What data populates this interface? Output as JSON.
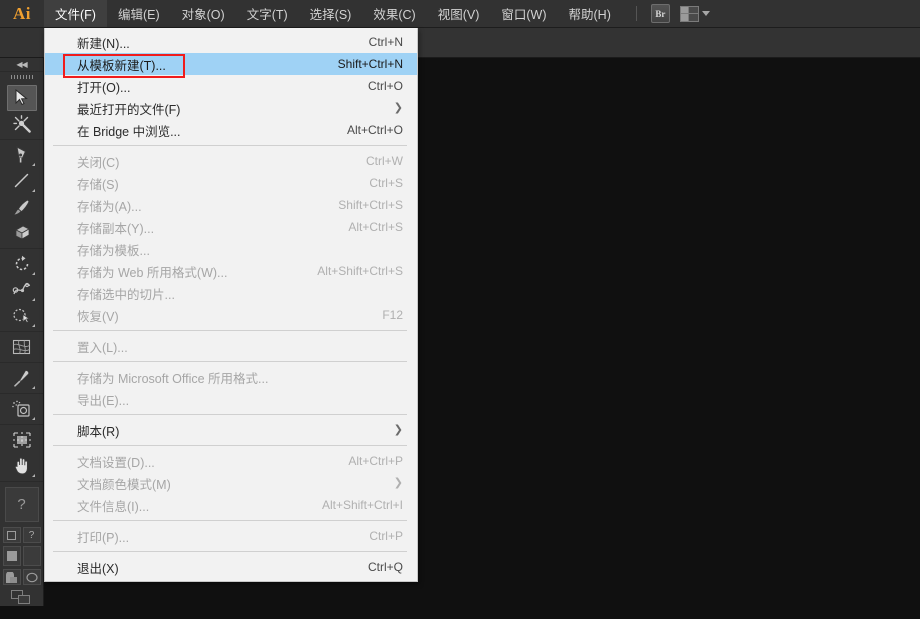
{
  "app": {
    "logo": "Ai",
    "brand_color": "#f0a030"
  },
  "menubar": {
    "items": [
      {
        "label": "文件(F)",
        "active": true
      },
      {
        "label": "编辑(E)",
        "active": false
      },
      {
        "label": "对象(O)",
        "active": false
      },
      {
        "label": "文字(T)",
        "active": false
      },
      {
        "label": "选择(S)",
        "active": false
      },
      {
        "label": "效果(C)",
        "active": false
      },
      {
        "label": "视图(V)",
        "active": false
      },
      {
        "label": "窗口(W)",
        "active": false
      },
      {
        "label": "帮助(H)",
        "active": false
      }
    ],
    "bridge_button": "Br",
    "workspace_switcher": "workspace-grid-icon"
  },
  "file_menu": {
    "title": "文件(F)",
    "highlight_color": "#9fd2f5",
    "annotation_color": "#f01c1c",
    "annotated_item": "从模板新建(T)...",
    "groups": [
      {
        "items": [
          {
            "label": "新建(N)...",
            "accel": "Ctrl+N",
            "disabled": false,
            "highlighted": false,
            "submenu": false
          },
          {
            "label": "从模板新建(T)...",
            "accel": "Shift+Ctrl+N",
            "disabled": false,
            "highlighted": true,
            "submenu": false,
            "annotated": true
          },
          {
            "label": "打开(O)...",
            "accel": "Ctrl+O",
            "disabled": false,
            "highlighted": false,
            "submenu": false
          },
          {
            "label": "最近打开的文件(F)",
            "accel": "",
            "disabled": false,
            "highlighted": false,
            "submenu": true
          },
          {
            "label": "在 Bridge 中浏览...",
            "accel": "Alt+Ctrl+O",
            "disabled": false,
            "highlighted": false,
            "submenu": false
          }
        ]
      },
      {
        "items": [
          {
            "label": "关闭(C)",
            "accel": "Ctrl+W",
            "disabled": true,
            "highlighted": false,
            "submenu": false
          },
          {
            "label": "存储(S)",
            "accel": "Ctrl+S",
            "disabled": true,
            "highlighted": false,
            "submenu": false
          },
          {
            "label": "存储为(A)...",
            "accel": "Shift+Ctrl+S",
            "disabled": true,
            "highlighted": false,
            "submenu": false
          },
          {
            "label": "存储副本(Y)...",
            "accel": "Alt+Ctrl+S",
            "disabled": true,
            "highlighted": false,
            "submenu": false
          },
          {
            "label": "存储为模板...",
            "accel": "",
            "disabled": true,
            "highlighted": false,
            "submenu": false
          },
          {
            "label": "存储为 Web 所用格式(W)...",
            "accel": "Alt+Shift+Ctrl+S",
            "disabled": true,
            "highlighted": false,
            "submenu": false
          },
          {
            "label": "存储选中的切片...",
            "accel": "",
            "disabled": true,
            "highlighted": false,
            "submenu": false
          },
          {
            "label": "恢复(V)",
            "accel": "F12",
            "disabled": true,
            "highlighted": false,
            "submenu": false
          }
        ]
      },
      {
        "items": [
          {
            "label": "置入(L)...",
            "accel": "",
            "disabled": true,
            "highlighted": false,
            "submenu": false
          }
        ]
      },
      {
        "items": [
          {
            "label": "存储为 Microsoft Office 所用格式...",
            "accel": "",
            "disabled": true,
            "highlighted": false,
            "submenu": false
          },
          {
            "label": "导出(E)...",
            "accel": "",
            "disabled": true,
            "highlighted": false,
            "submenu": false
          }
        ]
      },
      {
        "items": [
          {
            "label": "脚本(R)",
            "accel": "",
            "disabled": false,
            "highlighted": false,
            "submenu": true
          }
        ]
      },
      {
        "items": [
          {
            "label": "文档设置(D)...",
            "accel": "Alt+Ctrl+P",
            "disabled": true,
            "highlighted": false,
            "submenu": false
          },
          {
            "label": "文档颜色模式(M)",
            "accel": "",
            "disabled": true,
            "highlighted": false,
            "submenu": true
          },
          {
            "label": "文件信息(I)...",
            "accel": "Alt+Shift+Ctrl+I",
            "disabled": true,
            "highlighted": false,
            "submenu": false
          }
        ]
      },
      {
        "items": [
          {
            "label": "打印(P)...",
            "accel": "Ctrl+P",
            "disabled": true,
            "highlighted": false,
            "submenu": false
          }
        ]
      },
      {
        "items": [
          {
            "label": "退出(X)",
            "accel": "Ctrl+Q",
            "disabled": false,
            "highlighted": false,
            "submenu": false
          }
        ]
      }
    ]
  },
  "toolbar": {
    "collapse_label": "◀◀",
    "help_placeholder": "?",
    "groups": [
      {
        "tools": [
          {
            "name": "selection-tool",
            "selected": true,
            "has_flyout": false
          },
          {
            "name": "magic-wand-tool",
            "selected": false,
            "has_flyout": false
          }
        ]
      },
      {
        "tools": [
          {
            "name": "pen-tool",
            "selected": false,
            "has_flyout": true
          },
          {
            "name": "line-segment-tool",
            "selected": false,
            "has_flyout": true
          },
          {
            "name": "paintbrush-tool",
            "selected": false,
            "has_flyout": false
          },
          {
            "name": "blob-brush-tool",
            "selected": false,
            "has_flyout": false
          }
        ]
      },
      {
        "tools": [
          {
            "name": "rotate-tool",
            "selected": false,
            "has_flyout": true
          },
          {
            "name": "width-tool",
            "selected": false,
            "has_flyout": true
          },
          {
            "name": "shape-builder-tool",
            "selected": false,
            "has_flyout": true
          }
        ]
      },
      {
        "tools": [
          {
            "name": "mesh-tool",
            "selected": false,
            "has_flyout": false
          }
        ]
      },
      {
        "tools": [
          {
            "name": "eyedropper-tool",
            "selected": false,
            "has_flyout": true
          }
        ]
      },
      {
        "tools": [
          {
            "name": "symbol-sprayer-tool",
            "selected": false,
            "has_flyout": true
          }
        ]
      },
      {
        "tools": [
          {
            "name": "artboard-tool",
            "selected": false,
            "has_flyout": false
          },
          {
            "name": "hand-tool",
            "selected": false,
            "has_flyout": true
          }
        ]
      }
    ],
    "color_controls": {
      "fill_swatch": "fill-swatch",
      "stroke_swatch": "stroke-swatch",
      "color_mode": "color-icon",
      "gradient_mode": "gradient-icon",
      "none_mode": "none-icon",
      "drawing_mode": "draw-normal-icon"
    }
  }
}
